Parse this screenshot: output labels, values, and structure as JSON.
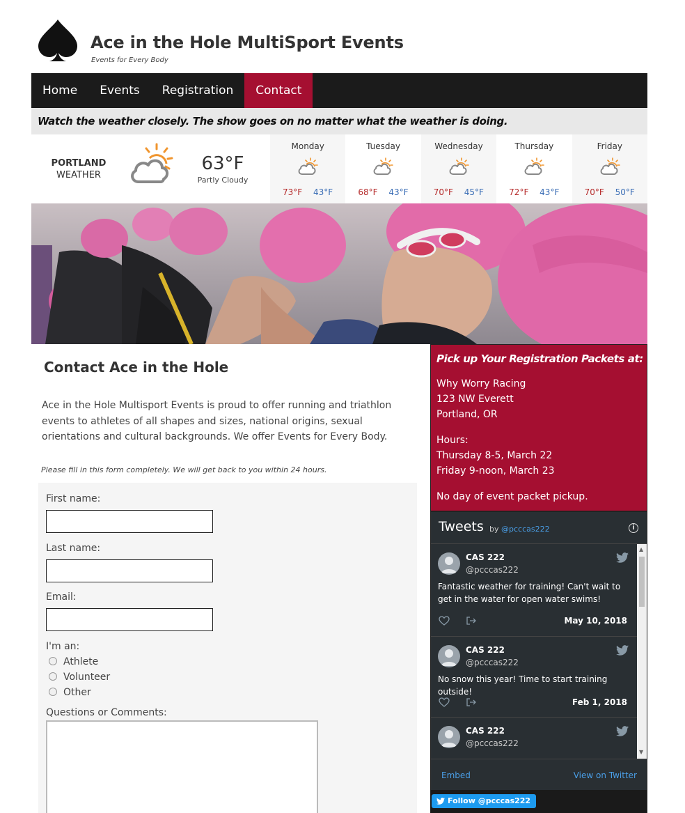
{
  "site": {
    "title": "Ace in the Hole MultiSport Events",
    "tagline": "Events for Every Body"
  },
  "nav": {
    "items": [
      "Home",
      "Events",
      "Registration",
      "Contact"
    ],
    "active": "Contact"
  },
  "notice": "Watch the weather closely. The show goes on no matter what the weather is doing.",
  "weather": {
    "city": "PORTLAND",
    "label": "WEATHER",
    "temp": "63°F",
    "condition": "Partly Cloudy",
    "forecast": [
      {
        "day": "Monday",
        "hi": "73°F",
        "lo": "43°F"
      },
      {
        "day": "Tuesday",
        "hi": "68°F",
        "lo": "43°F"
      },
      {
        "day": "Wednesday",
        "hi": "70°F",
        "lo": "45°F"
      },
      {
        "day": "Thursday",
        "hi": "72°F",
        "lo": "43°F"
      },
      {
        "day": "Friday",
        "hi": "70°F",
        "lo": "50°F"
      }
    ]
  },
  "main": {
    "heading": "Contact Ace in the Hole",
    "intro": "Ace in the Hole Multisport Events is proud to offer running and triathlon events to athletes of all shapes and sizes, national origins, sexual orientations and cultural backgrounds. We offer Events for Every Body.",
    "form_note": "Please fill in this form completely. We will get back to you within 24 hours.",
    "form": {
      "first_name_label": "First name:",
      "last_name_label": "Last name:",
      "email_label": "Email:",
      "role_label": "I'm an:",
      "roles": [
        "Athlete",
        "Volunteer",
        "Other"
      ],
      "comments_label": "Questions or Comments:"
    }
  },
  "packet": {
    "title": "Pick up Your Registration Packets at:",
    "lines": [
      "Why Worry Racing",
      "123 NW Everett",
      "Portland, OR"
    ],
    "hours_label": "Hours:",
    "hours": [
      "Thursday 8-5, March 22",
      "Friday 9-noon, March 23"
    ],
    "note": "No day of event packet pickup."
  },
  "twitter": {
    "title": "Tweets",
    "by": "by",
    "handle": "@pcccas222",
    "tweets": [
      {
        "name": "CAS 222",
        "handle": "@pcccas222",
        "text": "Fantastic weather for training! Can't wait to get in the water for open water swims!",
        "date": "May 10, 2018"
      },
      {
        "name": "CAS 222",
        "handle": "@pcccas222",
        "text": "No snow this year! Time to start training outside!",
        "date": "Feb 1, 2018"
      },
      {
        "name": "CAS 222",
        "handle": "@pcccas222",
        "text": "",
        "date": ""
      }
    ],
    "embed": "Embed",
    "view": "View on Twitter",
    "follow": "Follow @pcccas222"
  },
  "colors": {
    "accent": "#a50f31",
    "nav_bg": "#1b1b1b",
    "twitter_bg": "#292f33",
    "link_blue": "#4a9ee6"
  },
  "icons": [
    "spade-icon",
    "partly-cloudy-icon",
    "twitter-bird-icon",
    "heart-icon",
    "share-icon",
    "info-icon"
  ]
}
